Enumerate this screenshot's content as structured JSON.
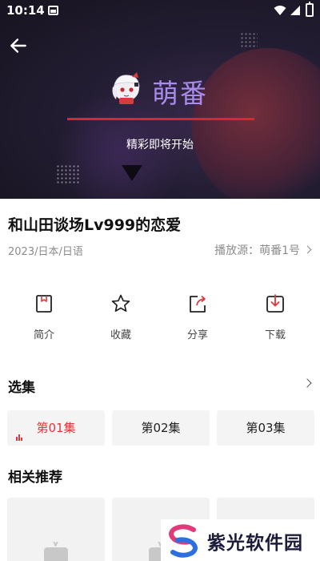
{
  "status_bar": {
    "time": "10:14"
  },
  "hero": {
    "logo_text": "萌番",
    "tagline": "精彩即将开始",
    "loading_progress_percent": 100
  },
  "video": {
    "title": "和山田谈场Lv999的恋爱",
    "meta": "2023/日本/日语",
    "source_label": "播放源：萌番1号"
  },
  "actions": [
    {
      "label": "简介",
      "icon": "bookmark-icon"
    },
    {
      "label": "收藏",
      "icon": "star-icon"
    },
    {
      "label": "分享",
      "icon": "share-icon"
    },
    {
      "label": "下载",
      "icon": "download-icon"
    }
  ],
  "episodes": {
    "title": "选集",
    "items": [
      {
        "label": "第01集",
        "active": true
      },
      {
        "label": "第02集",
        "active": false
      },
      {
        "label": "第03集",
        "active": false
      }
    ]
  },
  "recommendations": {
    "title": "相关推荐",
    "placeholder_icon": "tv-icon"
  },
  "watermark": {
    "text": "紫光软件园"
  },
  "colors": {
    "accent_red": "#e0383b",
    "logo_purple": "#a98bea",
    "hero_dark": "#1c1828"
  }
}
